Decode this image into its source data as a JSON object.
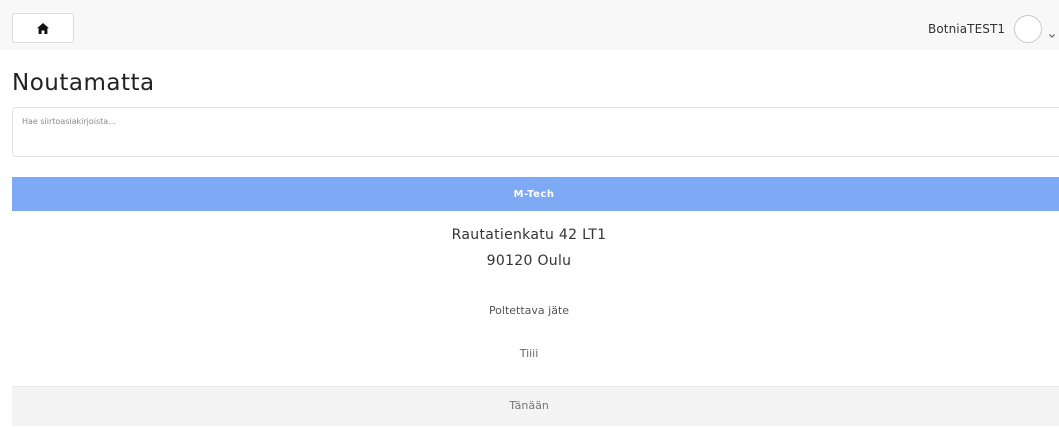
{
  "header": {
    "home_icon": "home-icon",
    "username": "BotniaTEST1",
    "avatar_icon": "avatar-icon",
    "chevron_icon": "chevron-down-icon"
  },
  "page": {
    "title": "Noutamatta"
  },
  "search": {
    "placeholder": "Hae siirtoasiakirjoista...",
    "value": ""
  },
  "card": {
    "company": "M-Tech",
    "address_line1": "Rautatienkatu 42 LT1",
    "address_line2": "90120 Oulu",
    "waste_type": "Poltettava jäte",
    "note": "Tiiii",
    "date": "Tänään",
    "header_color": "#7ea9f5"
  }
}
